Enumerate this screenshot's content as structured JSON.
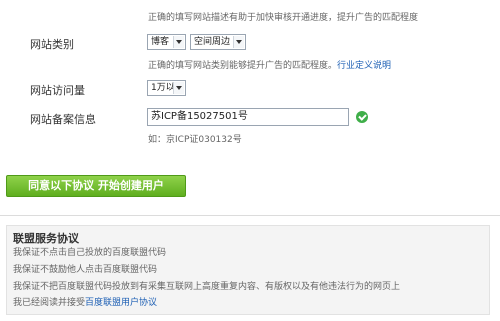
{
  "hints": {
    "top": "正确的填写网站描述有助于加快审核开通进度，提升广告的匹配程度",
    "category_prefix": "正确的填写网站类别能够提升广告的匹配程度。",
    "category_link": "行业定义说明",
    "icp_example": "如：京ICP证030132号"
  },
  "form": {
    "category_label": "网站类别",
    "category_primary": "博客",
    "category_secondary": "空间周边",
    "traffic_label": "网站访问量",
    "traffic_value": "1万以下",
    "icp_label": "网站备案信息",
    "icp_value": "苏ICP备15027501号"
  },
  "agree_button": "同意以下协议  开始创建用户",
  "agreement": {
    "title": "联盟服务协议",
    "lines": [
      "我保证不点击自己投放的百度联盟代码",
      "我保证不鼓励他人点击百度联盟代码",
      "我保证不把百度联盟代码投放到有采集互联网上高度重复内容、有版权以及有他违法行为的网页上"
    ],
    "last_prefix": "我已经阅读并接受",
    "last_link": "百度联盟用户协议"
  },
  "colors": {
    "link": "#1d5fb4",
    "button_green": "#6cbb2a",
    "check_green": "#3fae49"
  }
}
